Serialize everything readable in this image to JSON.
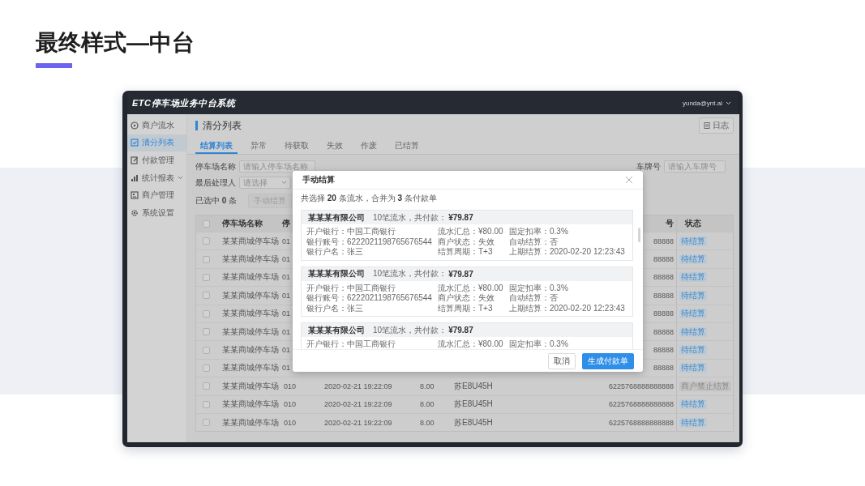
{
  "slide": {
    "title": "最终样式—中台"
  },
  "app": {
    "title": "ETC停车场业务中台系统",
    "user": "yunda@ynt.ai"
  },
  "sidebar": {
    "items": [
      {
        "label": "商户流水",
        "selected": false,
        "expandable": false
      },
      {
        "label": "清分列表",
        "selected": true,
        "expandable": false
      },
      {
        "label": "付款管理",
        "selected": false,
        "expandable": false
      },
      {
        "label": "统计报表",
        "selected": false,
        "expandable": true
      },
      {
        "label": "商户管理",
        "selected": false,
        "expandable": false
      },
      {
        "label": "系统设置",
        "selected": false,
        "expandable": false
      }
    ]
  },
  "page": {
    "title": "清分列表",
    "log_button": "日志"
  },
  "tabs": [
    {
      "label": "结算列表",
      "selected": true
    },
    {
      "label": "异常",
      "selected": false
    },
    {
      "label": "待获取",
      "selected": false
    },
    {
      "label": "失效",
      "selected": false
    },
    {
      "label": "作废",
      "selected": false
    },
    {
      "label": "已结算",
      "selected": false
    }
  ],
  "filter_rows": [
    [
      {
        "label": "停车场名称",
        "placeholder": "请输入停车场名称",
        "kind": "input"
      },
      {
        "label": "车牌号",
        "placeholder": "请输入车牌号",
        "kind": "input"
      }
    ],
    [
      {
        "label": "最后处理人",
        "placeholder": "请选择",
        "kind": "select"
      }
    ]
  ],
  "selection": {
    "text": "已选中 **0** 条",
    "button": "手动结算",
    "button_disabled": true
  },
  "table": {
    "select_all_checked": false,
    "columns": [
      {
        "label": "停车场名称"
      },
      {
        "label": "停"
      },
      {
        "label": "号"
      },
      {
        "label": "状态"
      }
    ],
    "rows": [
      {
        "kind": "covered",
        "checked": false,
        "cells": [
          "某某商城停车场",
          "01",
          "88888"
        ],
        "status": {
          "label": "待结算",
          "kind": "pending"
        }
      },
      {
        "kind": "covered",
        "checked": false,
        "cells": [
          "某某商城停车场",
          "01",
          "88888"
        ],
        "status": {
          "label": "待结算",
          "kind": "pending"
        }
      },
      {
        "kind": "covered",
        "checked": false,
        "cells": [
          "某某商城停车场",
          "01",
          "88888"
        ],
        "status": {
          "label": "待结算",
          "kind": "pending"
        }
      },
      {
        "kind": "covered",
        "checked": false,
        "cells": [
          "某某商城停车场",
          "01",
          "88888"
        ],
        "status": {
          "label": "待结算",
          "kind": "pending"
        }
      },
      {
        "kind": "covered",
        "checked": false,
        "cells": [
          "某某商城停车场",
          "01",
          "88888"
        ],
        "status": {
          "label": "待结算",
          "kind": "pending"
        }
      },
      {
        "kind": "covered",
        "checked": false,
        "cells": [
          "某某商城停车场",
          "01",
          "88888"
        ],
        "status": {
          "label": "待结算",
          "kind": "pending"
        }
      },
      {
        "kind": "covered",
        "checked": false,
        "cells": [
          "某某商城停车场",
          "01",
          "88888"
        ],
        "status": {
          "label": "待结算",
          "kind": "pending"
        }
      },
      {
        "kind": "covered",
        "checked": false,
        "cells": [
          "某某商城停车场",
          "01",
          "88888"
        ],
        "status": {
          "label": "待结算",
          "kind": "pending"
        }
      },
      {
        "kind": "full",
        "checked": false,
        "cells": [
          "某某商城停车场",
          "010",
          "2020-02-21 19:22:09",
          "8.00",
          "苏E8U45H",
          "6225768888888888"
        ],
        "status": {
          "label": "商户禁止结算",
          "kind": "blocked"
        }
      },
      {
        "kind": "full",
        "checked": false,
        "cells": [
          "某某商城停车场",
          "010",
          "2020-02-21 19:22:09",
          "8.00",
          "苏E8U45H",
          "6225768888888888"
        ],
        "status": {
          "label": "待结算",
          "kind": "pending"
        }
      },
      {
        "kind": "full",
        "checked": false,
        "cells": [
          "某某商城停车场",
          "010",
          "2020-02-21 19:22:09",
          "8.00",
          "苏E8U45H",
          "6225768888888888"
        ],
        "status": {
          "label": "待结算",
          "kind": "pending"
        }
      }
    ]
  },
  "modal": {
    "title": "手动结算",
    "summary": "共选择 **20** 条流水，合并为 **3** 条付款单",
    "cards": [
      {
        "company": "某某某有限公司",
        "summary": "10笔流水，共付款：",
        "amount": "¥79.87",
        "fields": [
          "开户银行：中国工商银行",
          "流水汇总：¥80.00",
          "固定扣率：0.3%",
          "银行账号：6222021198765676544",
          "商户状态：失效",
          "自动结算：否",
          "银行户名：张三",
          "结算周期：T+3",
          "上期结算：2020-02-20  12:23:43"
        ]
      },
      {
        "company": "某某某有限公司",
        "summary": "10笔流水，共付款：",
        "amount": "¥79.87",
        "fields": [
          "开户银行：中国工商银行",
          "流水汇总：¥80.00",
          "固定扣率：0.3%",
          "银行账号：6222021198765676544",
          "商户状态：失效",
          "自动结算：否",
          "银行户名：张三",
          "结算周期：T+3",
          "上期结算：2020-02-20  12:23:43"
        ]
      },
      {
        "company": "某某某有限公司",
        "summary": "10笔流水，共付款：",
        "amount": "¥79.87",
        "fields": [
          "开户银行：中国工商银行",
          "流水汇总：¥80.00",
          "固定扣率：0.3%"
        ]
      }
    ],
    "buttons": [
      {
        "label": "取消",
        "kind": "default"
      },
      {
        "label": "生成付款单",
        "kind": "primary"
      }
    ]
  }
}
